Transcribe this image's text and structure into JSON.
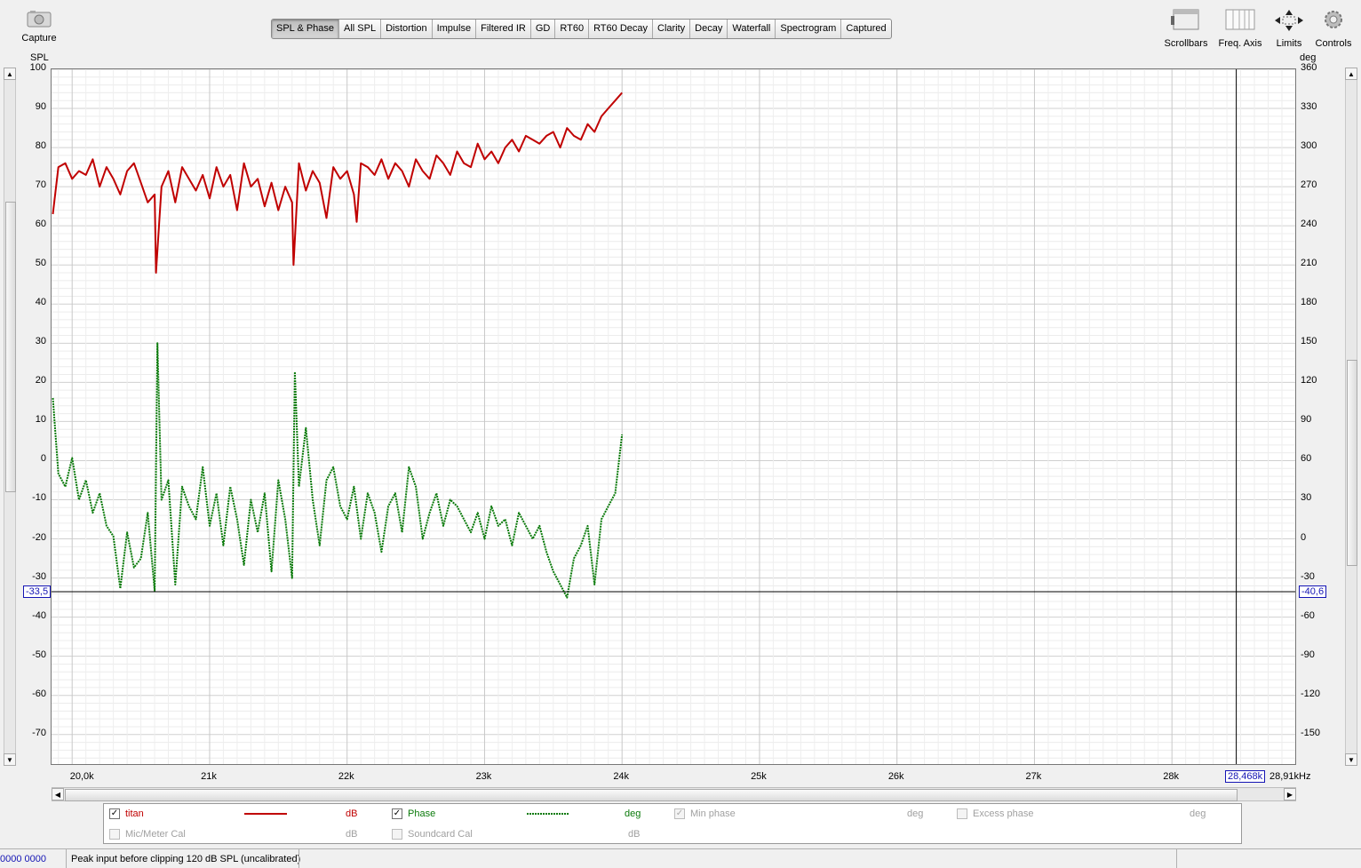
{
  "toolbar": {
    "capture_label": "Capture",
    "tabs": [
      "SPL & Phase",
      "All SPL",
      "Distortion",
      "Impulse",
      "Filtered IR",
      "GD",
      "RT60",
      "RT60 Decay",
      "Clarity",
      "Decay",
      "Waterfall",
      "Spectrogram",
      "Captured"
    ],
    "active_tab": "SPL & Phase",
    "right_buttons": {
      "scrollbars": "Scrollbars",
      "freq_axis": "Freq. Axis",
      "limits": "Limits",
      "controls": "Controls"
    }
  },
  "axes": {
    "left_unit": "SPL",
    "right_unit": "deg",
    "left_ticks": [
      "100",
      "90",
      "80",
      "70",
      "60",
      "50",
      "40",
      "30",
      "20",
      "10",
      "0",
      "-10",
      "-20",
      "-30",
      "-40",
      "-50",
      "-60",
      "-70"
    ],
    "right_ticks": [
      "360",
      "330",
      "300",
      "270",
      "240",
      "210",
      "180",
      "150",
      "120",
      "90",
      "60",
      "30",
      "0",
      "-30",
      "-60",
      "-90",
      "-120",
      "-150"
    ],
    "x_ticks": [
      "20,0k",
      "21k",
      "22k",
      "23k",
      "24k",
      "25k",
      "26k",
      "27k",
      "28k"
    ],
    "x_end_label": "28,91kHz",
    "cursor_x": "28,468k",
    "cursor_left": "-33,5",
    "cursor_right": "-40,6"
  },
  "chart_data": {
    "type": "line",
    "x_unit": "Hz",
    "xlim": [
      19850,
      28910
    ],
    "ylim_left": [
      -78,
      100
    ],
    "ylim_right": [
      -174,
      360
    ],
    "cursor": {
      "x": 28468,
      "left_value": -33.5,
      "right_value": -40.6
    },
    "series": [
      {
        "name": "titan",
        "axis": "left",
        "unit": "dB",
        "color": "#c00000",
        "style": "solid",
        "x": [
          19860,
          19900,
          19950,
          20000,
          20050,
          20100,
          20150,
          20200,
          20250,
          20300,
          20350,
          20400,
          20450,
          20500,
          20550,
          20600,
          20610,
          20650,
          20700,
          20750,
          20800,
          20850,
          20900,
          20950,
          21000,
          21050,
          21100,
          21150,
          21200,
          21250,
          21300,
          21350,
          21400,
          21450,
          21500,
          21550,
          21600,
          21610,
          21650,
          21700,
          21750,
          21800,
          21850,
          21900,
          21950,
          22000,
          22050,
          22070,
          22100,
          22150,
          22200,
          22250,
          22300,
          22350,
          22400,
          22450,
          22500,
          22550,
          22600,
          22650,
          22700,
          22750,
          22800,
          22850,
          22900,
          22950,
          23000,
          23050,
          23100,
          23150,
          23200,
          23250,
          23300,
          23350,
          23400,
          23450,
          23500,
          23550,
          23600,
          23650,
          23700,
          23750,
          23800,
          23850,
          23900,
          23950,
          24000
        ],
        "y": [
          63,
          75,
          76,
          72,
          74,
          73,
          77,
          70,
          75,
          72,
          68,
          74,
          76,
          71,
          66,
          68,
          48,
          70,
          74,
          66,
          75,
          72,
          69,
          73,
          67,
          75,
          70,
          73,
          64,
          76,
          70,
          72,
          65,
          71,
          64,
          70,
          66,
          50,
          76,
          69,
          74,
          71,
          62,
          75,
          72,
          74,
          68,
          61,
          76,
          75,
          73,
          77,
          72,
          76,
          74,
          70,
          77,
          74,
          72,
          78,
          76,
          73,
          79,
          76,
          75,
          81,
          77,
          79,
          76,
          80,
          82,
          79,
          83,
          82,
          81,
          83,
          84,
          80,
          85,
          83,
          82,
          86,
          84,
          88,
          90,
          92,
          94
        ]
      },
      {
        "name": "Phase",
        "axis": "right",
        "unit": "deg",
        "color": "#0a7a0a",
        "style": "dotted",
        "x": [
          19860,
          19900,
          19950,
          20000,
          20050,
          20100,
          20150,
          20200,
          20250,
          20300,
          20350,
          20400,
          20450,
          20500,
          20550,
          20600,
          20620,
          20650,
          20700,
          20750,
          20800,
          20850,
          20900,
          20950,
          21000,
          21050,
          21100,
          21150,
          21200,
          21250,
          21300,
          21350,
          21400,
          21450,
          21500,
          21550,
          21600,
          21620,
          21650,
          21700,
          21750,
          21800,
          21850,
          21900,
          21950,
          22000,
          22050,
          22100,
          22150,
          22200,
          22250,
          22300,
          22350,
          22400,
          22450,
          22500,
          22550,
          22600,
          22650,
          22700,
          22750,
          22800,
          22850,
          22900,
          22950,
          23000,
          23050,
          23100,
          23150,
          23200,
          23250,
          23300,
          23350,
          23400,
          23450,
          23500,
          23550,
          23600,
          23650,
          23700,
          23750,
          23800,
          23850,
          23900,
          23950,
          24000
        ],
        "y": [
          108,
          50,
          40,
          62,
          30,
          45,
          20,
          35,
          10,
          2,
          -38,
          5,
          -22,
          -15,
          20,
          -40,
          150,
          30,
          45,
          -35,
          40,
          25,
          15,
          55,
          10,
          35,
          -5,
          40,
          15,
          -20,
          30,
          5,
          35,
          -25,
          45,
          15,
          -30,
          128,
          40,
          85,
          30,
          -5,
          45,
          55,
          25,
          15,
          40,
          0,
          35,
          20,
          -10,
          25,
          35,
          5,
          55,
          40,
          0,
          20,
          35,
          10,
          30,
          25,
          15,
          5,
          20,
          0,
          25,
          10,
          15,
          -5,
          20,
          10,
          0,
          10,
          -10,
          -25,
          -35,
          -45,
          -15,
          -5,
          10,
          -35,
          15,
          25,
          35,
          80
        ]
      }
    ]
  },
  "legend": {
    "row1": [
      {
        "checked": true,
        "label": "titan",
        "unit": "dB",
        "enabled": true
      },
      {
        "checked": true,
        "label": "Phase",
        "unit": "deg",
        "enabled": true
      },
      {
        "checked": true,
        "label": "Min phase",
        "unit": "deg",
        "enabled": false
      },
      {
        "checked": false,
        "label": "Excess phase",
        "unit": "deg",
        "enabled": false
      }
    ],
    "row2": [
      {
        "checked": false,
        "label": "Mic/Meter Cal",
        "unit": "dB",
        "enabled": false
      },
      {
        "checked": false,
        "label": "Soundcard Cal",
        "unit": "dB",
        "enabled": false
      }
    ]
  },
  "status": {
    "code": "0000 0000",
    "message": "Peak input before clipping 120 dB SPL (uncalibrated)"
  }
}
